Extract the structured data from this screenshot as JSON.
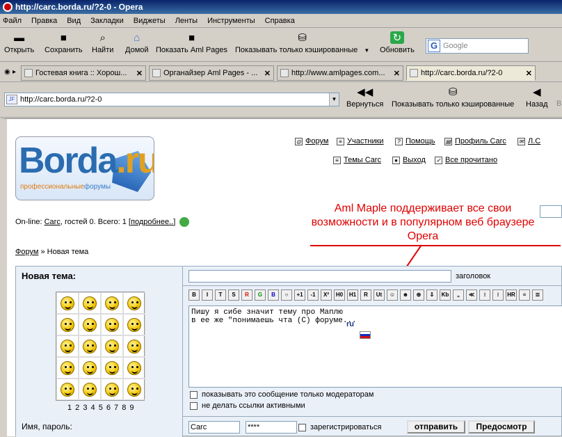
{
  "window": {
    "title": "http://carc.borda.ru/?2-0 - Opera"
  },
  "menu": [
    "Файл",
    "Правка",
    "Вид",
    "Закладки",
    "Виджеты",
    "Ленты",
    "Инструменты",
    "Справка"
  ],
  "toolbar": {
    "open": "Открыть",
    "save": "Сохранить",
    "find": "Найти",
    "home": "Домой",
    "show_aml": "Показать Aml Pages",
    "cached_only": "Показывать только кэшированные",
    "refresh": "Обновить"
  },
  "search": {
    "placeholder": "Google"
  },
  "tabs": [
    {
      "label": "Гостевая книга :: Хорош..."
    },
    {
      "label": "Органайзер Aml Pages - ..."
    },
    {
      "label": "http://www.amlpages.com..."
    },
    {
      "label": "http://carc.borda.ru/?2-0"
    }
  ],
  "address": {
    "url": "http://carc.borda.ru/?2-0",
    "back": "Вернуться",
    "cached_only": "Показывать только кэшированные",
    "prev": "Назад",
    "next": "В"
  },
  "logo": {
    "main": "Borda",
    "tld": ".ru",
    "tag_a": "профессиональные",
    "tag_b": "форумы"
  },
  "nav": {
    "forum": "Форум",
    "members": "Участники",
    "help": "Помощь",
    "profile": "Профиль Carc",
    "pm": "Л.С",
    "topics": "Темы Carc",
    "logout": "Выход",
    "all_read": "Все прочитано"
  },
  "online": {
    "prefix": "On-line:",
    "user": "Carc",
    "rest": ", гостей 0. Всего: 1 [",
    "more": "подробнее..",
    "close": "]"
  },
  "crumbs": {
    "forum": "Форум",
    "sep": " » ",
    "current": "Новая тема"
  },
  "annotation": "Aml Maple поддерживает все свои возможности и в популярном веб браузере Opera",
  "form": {
    "new_topic_label": "Новая тема:",
    "title_hint": "заголовок",
    "pages": "1 2 3 4 5 6 7 8 9",
    "format_buttons": [
      "B",
      "I",
      "T",
      "S",
      "R",
      "G",
      "B",
      "○",
      "+1",
      "-1",
      "X²",
      "H0",
      "H1",
      "R",
      "Ut",
      "☺",
      "☻",
      "⊕",
      "⇩",
      "Kb",
      "„",
      "≪",
      "⁝",
      "⁝",
      "HR",
      "≡",
      "≣"
    ],
    "message": "Пишу я сибе значит тему про Маплю\nв ее же \"понимаешь чта (С) форуме...",
    "ime_tag": "ru",
    "moderators_only": "показывать это сообщение только модераторам",
    "no_active_links": "не делать ссылки активными",
    "login_label": "Имя, пароль:",
    "user": "Carc",
    "password": "****",
    "register": "зарегистрироваться",
    "send": "отправить",
    "preview": "Предосмотр"
  }
}
